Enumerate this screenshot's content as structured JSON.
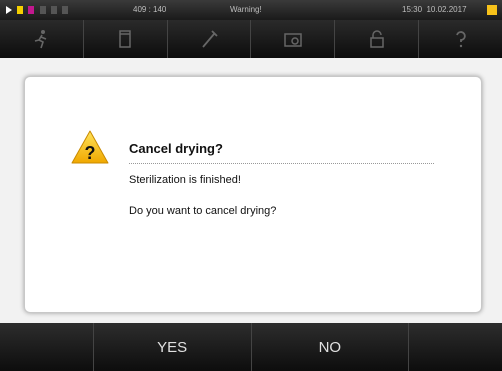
{
  "status": {
    "counter": "409 : 140",
    "title": "Warning!",
    "time": "15:30",
    "date": "10.02.2017"
  },
  "toolbar": {
    "icons": [
      "running-person-icon",
      "document-icon",
      "tool-icon",
      "folder-icon",
      "lock-icon",
      "help-icon"
    ]
  },
  "dialog": {
    "title": "Cancel drying?",
    "message1": "Sterilization is finished!",
    "message2": "Do you want to cancel drying?",
    "icon": "warning-icon"
  },
  "buttons": {
    "yes": "YES",
    "no": "NO"
  },
  "colors": {
    "warning": "#f7c21a",
    "background": "#f2f2f2"
  }
}
